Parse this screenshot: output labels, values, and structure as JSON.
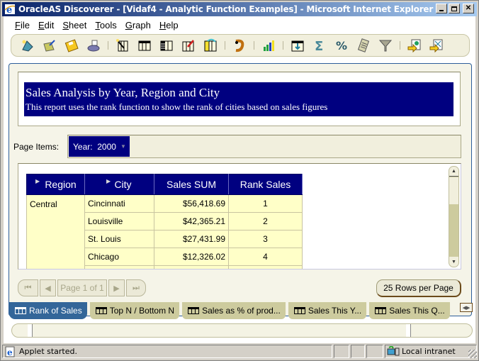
{
  "window": {
    "title": "OracleAS Discoverer - [Vidaf4 - Analytic Function Examples] - Microsoft Internet Explorer",
    "controls": [
      "minimize",
      "maximize",
      "close"
    ]
  },
  "menubar": {
    "items": [
      {
        "label": "File",
        "accel": "F"
      },
      {
        "label": "Edit",
        "accel": "E"
      },
      {
        "label": "Sheet",
        "accel": "S"
      },
      {
        "label": "Tools",
        "accel": "T"
      },
      {
        "label": "Graph",
        "accel": "G"
      },
      {
        "label": "Help",
        "accel": "H"
      }
    ]
  },
  "toolbar": {
    "groups": [
      [
        "new-workbook-icon",
        "open-workbook-icon",
        "save-icon",
        "print-icon"
      ],
      [
        "edit-sheet-wizard-icon",
        "table-layout-icon",
        "crosstab-layout-icon",
        "edit-title-icon",
        "duplicate-sheet-icon"
      ],
      [
        "undo-icon"
      ],
      [
        "graph-icon"
      ],
      [
        "drill-icon",
        "totals-sigma-icon",
        "percentage-icon",
        "calculations-icon",
        "filter-icon"
      ],
      [
        "export-icon",
        "send-email-icon"
      ]
    ]
  },
  "report": {
    "title": "Sales Analysis by Year, Region and City",
    "subtitle": "This report uses the rank function to show the rank of cities based on sales figures"
  },
  "page_items": {
    "label": "Page Items:",
    "selector": "Year:  2000"
  },
  "grid": {
    "columns": [
      "Region",
      "City",
      "Sales SUM",
      "Rank Sales"
    ],
    "region": "Central",
    "rows": [
      {
        "city": "Cincinnati",
        "sales": "$56,418.69",
        "rank": "1"
      },
      {
        "city": "Louisville",
        "sales": "$42,365.21",
        "rank": "2"
      },
      {
        "city": "St. Louis",
        "sales": "$27,431.99",
        "rank": "3"
      },
      {
        "city": "Chicago",
        "sales": "$12,326.02",
        "rank": "4"
      }
    ]
  },
  "pager": {
    "page_label": "Page 1 of 1",
    "rows_per_page": "25 Rows per Page"
  },
  "tabs": [
    {
      "label": "Rank of Sales",
      "active": true
    },
    {
      "label": "Top N / Bottom N",
      "active": false
    },
    {
      "label": "Sales as % of prod...",
      "active": false
    },
    {
      "label": "Sales This Y...",
      "active": false
    },
    {
      "label": "Sales This Q...",
      "active": false
    }
  ],
  "statusbar": {
    "message": "Applet started.",
    "zone": "Local intranet"
  },
  "colors": {
    "title_band": "#000080",
    "grid_cell": "#ffffc8",
    "active_tab": "#336699",
    "inactive_tab": "#cdcb9e",
    "panel_bg": "#f5f4e8"
  }
}
